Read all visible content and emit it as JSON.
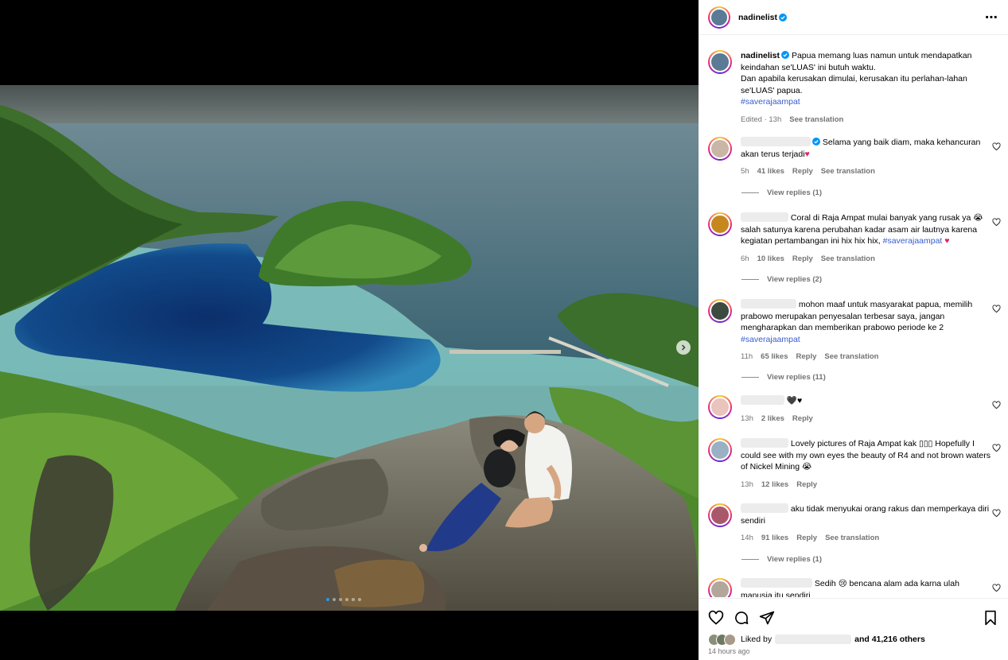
{
  "post": {
    "username": "nadinelist",
    "caption": {
      "line1": "Papua memang luas namun untuk mendapatkan keindahan se'LUAS' ini butuh waktu.",
      "line2": "Dan apabila kerusakan dimulai, kerusakan itu perlahan-lahan se'LUAS' papua.",
      "hashtag": "#saverajaampat",
      "edited": "Edited · 13h",
      "see_translation": "See translation"
    },
    "carousel": {
      "slides": 6,
      "active": 0
    }
  },
  "comments": [
    {
      "text": "Selama yang baik diam, maka kehancuran akan terus terjadi",
      "emoji": "♥",
      "time": "5h",
      "likes": "41 likes",
      "reply": "Reply",
      "translate": "See translation",
      "replies": "View replies (1)",
      "verified": true
    },
    {
      "text": "Coral di Raja Ampat mulai banyak yang rusak ya 😭 salah satunya karena perubahan kadar asam air lautnya karena kegiatan pertambangan ini hix hix hix,",
      "hashtag": "#saverajaampat",
      "emoji": "♥",
      "time": "6h",
      "likes": "10 likes",
      "reply": "Reply",
      "translate": "See translation",
      "replies": "View replies (2)"
    },
    {
      "text": "mohon maaf untuk masyarakat papua, memilih prabowo merupakan penyesalan terbesar saya, jangan mengharapkan dan memberikan prabowo periode ke 2",
      "hashtag": "#saverajaampat",
      "time": "11h",
      "likes": "65 likes",
      "reply": "Reply",
      "translate": "See translation",
      "replies": "View replies (11)"
    },
    {
      "text": "🖤♥",
      "time": "13h",
      "likes": "2 likes",
      "reply": "Reply"
    },
    {
      "text": "Lovely pictures of Raja Ampat kak ▯▯▯ Hopefully I could see with my own eyes the beauty of R4 and not brown waters of Nickel Mining 😭",
      "time": "13h",
      "likes": "12 likes",
      "reply": "Reply"
    },
    {
      "text": "aku tidak menyukai orang rakus dan memperkaya diri sendiri",
      "time": "14h",
      "likes": "91 likes",
      "reply": "Reply",
      "translate": "See translation",
      "replies": "View replies (1)"
    },
    {
      "text": "Sedih 😢 bencana alam ada karna ulah manusia itu sendiri"
    }
  ],
  "footer": {
    "liked_by": "Liked by",
    "and_others": "and 41,216 others",
    "time_ago": "14 hours ago"
  },
  "icons": [
    "more-icon",
    "heart-icon",
    "comment-icon",
    "share-icon",
    "bookmark-icon",
    "chevron-right-icon",
    "verified-icon"
  ]
}
